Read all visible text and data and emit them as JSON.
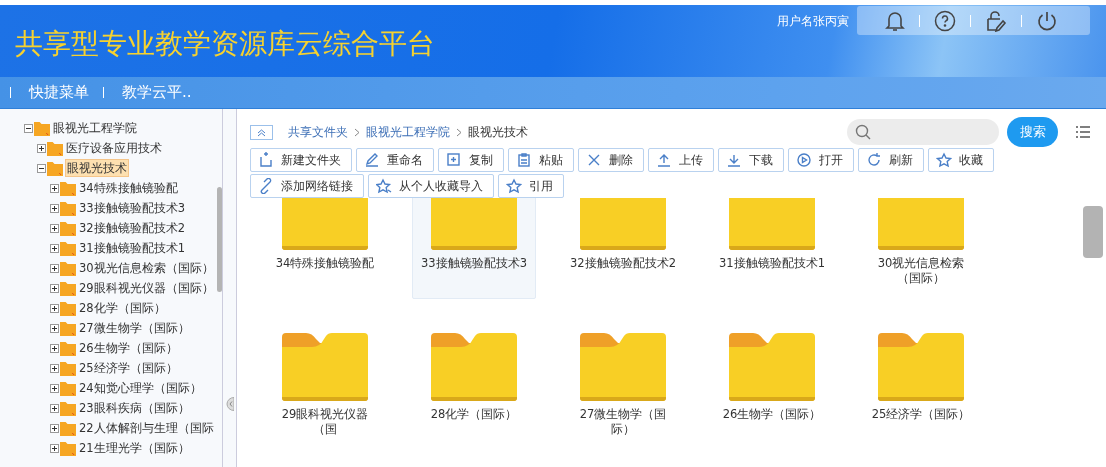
{
  "header": {
    "title": "共享型专业教学资源库云综合平台",
    "username": "用户名张丙寅"
  },
  "nav": {
    "items": [
      "快捷菜单",
      "教学云平.."
    ]
  },
  "tree": [
    {
      "label": "眼视光工程学院",
      "expanded": true,
      "selected": false,
      "children": [
        {
          "label": "医疗设备应用技术",
          "expanded": false,
          "selected": false
        },
        {
          "label": "眼视光技术",
          "expanded": true,
          "selected": true,
          "children": [
            {
              "label": "34特殊接触镜验配",
              "expanded": false,
              "selected": false
            },
            {
              "label": "33接触镜验配技术3",
              "expanded": false,
              "selected": false
            },
            {
              "label": "32接触镜验配技术2",
              "expanded": false,
              "selected": false
            },
            {
              "label": "31接触镜验配技术1",
              "expanded": false,
              "selected": false
            },
            {
              "label": "30视光信息检索（国际）",
              "expanded": false,
              "selected": false
            },
            {
              "label": "29眼科视光仪器（国际）",
              "expanded": false,
              "selected": false
            },
            {
              "label": "28化学（国际）",
              "expanded": false,
              "selected": false
            },
            {
              "label": "27微生物学（国际）",
              "expanded": false,
              "selected": false
            },
            {
              "label": "26生物学（国际）",
              "expanded": false,
              "selected": false
            },
            {
              "label": "25经济学（国际）",
              "expanded": false,
              "selected": false
            },
            {
              "label": "24知觉心理学（国际）",
              "expanded": false,
              "selected": false
            },
            {
              "label": "23眼科疾病（国际）",
              "expanded": false,
              "selected": false
            },
            {
              "label": "22人体解剖与生理（国际",
              "expanded": false,
              "selected": false
            },
            {
              "label": "21生理光学（国际）",
              "expanded": false,
              "selected": false
            }
          ]
        }
      ]
    }
  ],
  "breadcrumb": [
    "共享文件夹",
    "眼视光工程学院",
    "眼视光技术"
  ],
  "search_button": "搜索",
  "toolbar": [
    "新建文件夹",
    "重命名",
    "复制",
    "粘贴",
    "删除",
    "上传",
    "下载",
    "打开",
    "刷新",
    "收藏",
    "添加网络链接",
    "从个人收藏导入",
    "引用"
  ],
  "files": [
    {
      "name": "34特殊接触镜验配",
      "selected": false
    },
    {
      "name": "33接触镜验配技术3",
      "selected": true
    },
    {
      "name": "32接触镜验配技术2",
      "selected": false
    },
    {
      "name": "31接触镜验配技术1",
      "selected": false
    },
    {
      "name": "30视光信息检索（国际）",
      "selected": false
    },
    {
      "name": "29眼科视光仪器（国",
      "selected": false
    },
    {
      "name": "28化学（国际）",
      "selected": false
    },
    {
      "name": "27微生物学（国际）",
      "selected": false
    },
    {
      "name": "26生物学（国际）",
      "selected": false
    },
    {
      "name": "25经济学（国际）",
      "selected": false
    }
  ]
}
